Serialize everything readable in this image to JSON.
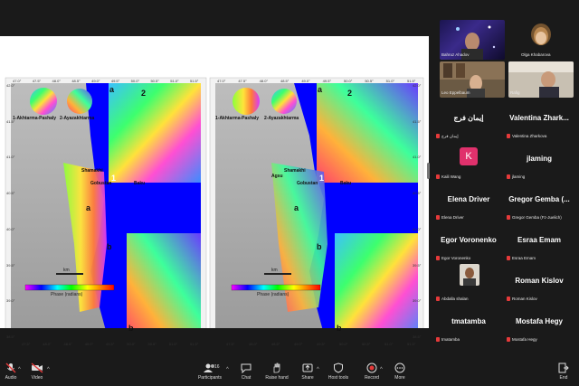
{
  "slide": {
    "left_map": {
      "labels": {
        "a_top": "a",
        "num1": "1",
        "num2": "2",
        "num1_small": "1",
        "a_mid": "a",
        "b_mid": "b",
        "b_bottom": "b",
        "akhtarma": "1-Akhtarma-Pashaly",
        "ayazakhtarma": "2-Ayazakhtarma",
        "shamakhi": "Shamakhi",
        "gobustan": "Gobustan",
        "baku": "Baku",
        "km": "km",
        "phase": "Phase (radians)"
      },
      "top_ticks": [
        "47.0°",
        "47.5°",
        "48.0°",
        "48.5°",
        "49.0°",
        "49.5°",
        "50.0°",
        "50.5°",
        "51.0°",
        "51.5°"
      ],
      "bottom_ticks": [
        "47.5°",
        "48.0°",
        "48.5°",
        "49.0°",
        "49.5°",
        "50.0°",
        "50.5°",
        "51.0°",
        "51.5°"
      ],
      "left_ticks": [
        "42.0°",
        "41.5°",
        "41.0°",
        "40.5°",
        "40.0°",
        "39.5°",
        "39.0°",
        "38.5°"
      ]
    },
    "right_map": {
      "labels": {
        "a_top": "a",
        "num1": "1",
        "num2": "2",
        "a_mid": "a",
        "b_mid": "b",
        "b_bottom": "b",
        "akhtarma": "1-Akhtarma-Pashaly",
        "ayazakhtarma": "2-Ayazakhtarma",
        "shamakhi": "Shamakhi",
        "gobustan": "Gobustan",
        "agsu": "Agsu",
        "baku": "Baku",
        "km": "km",
        "phase": "Phase (radians)"
      },
      "top_ticks": [
        "47.0°",
        "47.5°",
        "48.0°",
        "48.5°",
        "49.0°",
        "49.5°",
        "50.0°",
        "50.5°",
        "51.0°",
        "51.5°"
      ],
      "bottom_ticks": [
        "47.5°",
        "48.0°",
        "48.5°",
        "49.0°",
        "49.5°",
        "50.0°",
        "50.5°",
        "51.0°",
        "51.5°"
      ],
      "right_ticks": [
        "42.0°",
        "41.5°",
        "41.0°",
        "40.5°",
        "40.0°",
        "39.5°",
        "39.0°",
        "38.5°"
      ]
    }
  },
  "gallery": {
    "video_tiles": [
      {
        "name": "Bahruz Ahadov"
      },
      {
        "name": "Olga Khabarova"
      },
      {
        "name": "Leo Eppelbaum"
      },
      {
        "name": "Rafig"
      }
    ],
    "participants": [
      {
        "big": "إيمان فرج",
        "small": "إيمان فرج"
      },
      {
        "big": "Valentina Zhark...",
        "small": "Valentina Zharkova"
      },
      {
        "big": "K",
        "small": "Kaili Wang",
        "avatar": true
      },
      {
        "big": "jlaming",
        "small": "jlaming"
      },
      {
        "big": "Elena Driver",
        "small": "Elena Driver"
      },
      {
        "big": "Gregor Gemba (...",
        "small": "Gregor Gemba (Fz-Juelich)"
      },
      {
        "big": "Egor Voronenko",
        "small": "Egor Voronenko"
      },
      {
        "big": "Esraa Emam",
        "small": "Esraa Emam"
      },
      {
        "big": "",
        "small": "Abdalla shalan",
        "photo": true
      },
      {
        "big": "Roman Kislov",
        "small": "Roman Kislov"
      },
      {
        "big": "tmatamba",
        "small": "tmatamba"
      },
      {
        "big": "Mostafa Hegy",
        "small": "Mostafa Hegy"
      }
    ],
    "avatar_color": "#e0316c"
  },
  "toolbar": {
    "audio": "Audio",
    "video": "Video",
    "participants": "Participants",
    "participants_count": "16",
    "chat": "Chat",
    "raise_hand": "Raise hand",
    "share": "Share",
    "host_tools": "Host tools",
    "record": "Record",
    "more": "More",
    "end": "End"
  }
}
